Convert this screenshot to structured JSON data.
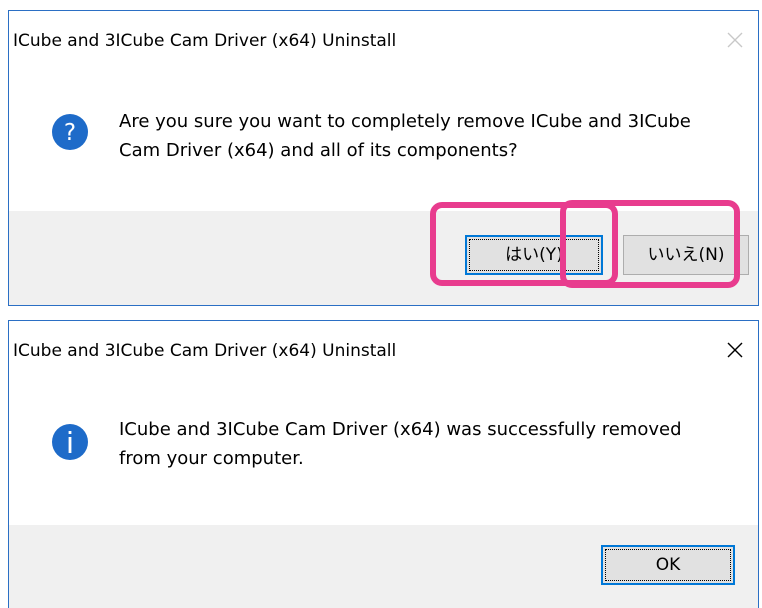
{
  "uninstall_confirm_dialog": {
    "title": "ICube and 3ICube Cam Driver (x64) Uninstall",
    "icon": "question-icon",
    "message": "Are you sure you want to completely remove ICube and 3ICube Cam Driver (x64) and all of its components?",
    "yes_label": "はい(Y)",
    "no_label": "いいえ(N)"
  },
  "uninstall_complete_dialog": {
    "title": "ICube and 3ICube Cam Driver (x64) Uninstall",
    "icon": "info-icon",
    "message": "ICube and 3ICube Cam Driver (x64) was successfully removed from your computer.",
    "ok_label": "OK"
  },
  "colors": {
    "highlight": "#e83c8e",
    "dialog_border": "#2b6fc4",
    "icon_blue": "#1e6bc9",
    "footer_bg": "#f0f0f0",
    "default_button_border": "#0078d7"
  }
}
